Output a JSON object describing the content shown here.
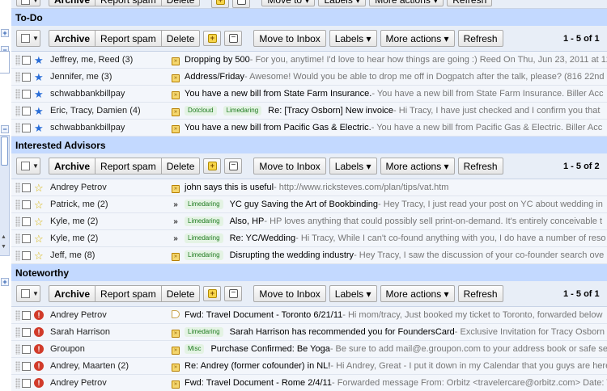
{
  "app": {
    "title": "Gmail - multiple inboxes"
  },
  "colors": {
    "section_bg": "#c3d9ff",
    "toolbar_bg": "#e8eef7",
    "row_bg": "#f3f6fb",
    "label_green_bg": "#e4f3e4",
    "label_green_text": "#1d7a1d",
    "important_red": "#d13b2a",
    "star_blue": "#2a6ed8"
  },
  "top_toolbar": {
    "archive": "Archive",
    "report_spam": "Report spam",
    "delete": "Delete",
    "move_to": "Move to ▾",
    "labels": "Labels ▾",
    "more_actions": "More actions ▾",
    "refresh": "Refresh"
  },
  "gutter_icons": [
    "expand-icon",
    "collapse-icon",
    "collapse-icon",
    "expand-icon"
  ],
  "sections": [
    {
      "title": "To-Do",
      "toolbar": {
        "archive": "Archive",
        "report_spam": "Report spam",
        "delete": "Delete",
        "move_to_inbox": "Move to Inbox",
        "labels": "Labels ▾",
        "more_actions": "More actions ▾",
        "refresh": "Refresh"
      },
      "count": "1 - 5 of 1",
      "rows": [
        {
          "from": "Jeffrey, me, Reed (3)",
          "star": "blue",
          "marker": "box",
          "labels": [],
          "subject": "Dropping by 500",
          "snippet": " - For you, anytime! I'd love to hear how things are going :) Reed On Thu, Jun 23, 2011 at 12"
        },
        {
          "from": "Jennifer, me (3)",
          "star": "blue",
          "marker": "box",
          "labels": [],
          "subject": "Address/Friday",
          "snippet": " - Awesome! Would you be able to drop me off in Dogpatch after the talk, please? (816 22nd"
        },
        {
          "from": "schwabbankbillpay",
          "star": "blue",
          "marker": "box",
          "labels": [],
          "subject": "You have a new bill from State Farm Insurance.",
          "snippet": " - You have a new bill from State Farm Insurance. Biller Acc"
        },
        {
          "from": "Eric, Tracy, Damien (4)",
          "star": "blue",
          "marker": "box",
          "labels": [
            "Dotcloud",
            "Limedaring"
          ],
          "subject": "Re: [Tracy Osborn] New invoice",
          "snippet": " - Hi Tracy, I have just checked and I confirm you that"
        },
        {
          "from": "schwabbankbillpay",
          "star": "blue",
          "marker": "box",
          "labels": [],
          "subject": "You have a new bill from Pacific Gas & Electric.",
          "snippet": " - You have a new bill from Pacific Gas & Electric. Biller Acc"
        }
      ]
    },
    {
      "title": "Interested Advisors",
      "toolbar": {
        "archive": "Archive",
        "report_spam": "Report spam",
        "delete": "Delete",
        "move_to_inbox": "Move to Inbox",
        "labels": "Labels ▾",
        "more_actions": "More actions ▾",
        "refresh": "Refresh"
      },
      "count": "1 - 5 of 2",
      "rows": [
        {
          "from": "Andrey Petrov",
          "star": "empty",
          "marker": "box",
          "labels": [],
          "subject": "john says this is useful",
          "snippet": " - http://www.ricksteves.com/plan/tips/vat.htm"
        },
        {
          "from": "Patrick, me (2)",
          "star": "empty",
          "marker": "double",
          "labels": [
            "Limedaring"
          ],
          "subject": "YC guy Saving the Art of Bookbinding",
          "snippet": " - Hey Tracy, I just read your post on YC about wedding in"
        },
        {
          "from": "Kyle, me (2)",
          "star": "empty",
          "marker": "double",
          "labels": [
            "Limedaring"
          ],
          "subject": "Also, HP",
          "snippet": " - HP loves anything that could possibly sell print-on-demand. It's entirely conceivable t"
        },
        {
          "from": "Kyle, me (2)",
          "star": "empty",
          "marker": "double",
          "labels": [
            "Limedaring"
          ],
          "subject": "Re: YC/Wedding",
          "snippet": " - Hi Tracy, While I can't co-found anything with you, I do have a number of reso"
        },
        {
          "from": "Jeff, me (8)",
          "star": "empty",
          "marker": "box",
          "labels": [
            "Limedaring"
          ],
          "subject": "Disrupting the wedding industry",
          "snippet": " - Hey Tracy, I saw the discussion of your co-founder search ove"
        }
      ]
    },
    {
      "title": "Noteworthy",
      "toolbar": {
        "archive": "Archive",
        "report_spam": "Report spam",
        "delete": "Delete",
        "move_to_inbox": "Move to Inbox",
        "labels": "Labels ▾",
        "more_actions": "More actions ▾",
        "refresh": "Refresh"
      },
      "count": "1 - 5 of 1",
      "rows": [
        {
          "from": "Andrey Petrov",
          "star": "important",
          "marker": "outline",
          "labels": [],
          "subject": "Fwd: Travel Document - Toronto 6/21/11",
          "snippet": " - Hi mom/tracy, Just booked my ticket to Toronto, forwarded below"
        },
        {
          "from": "Sarah Harrison",
          "star": "important",
          "marker": "box",
          "labels": [
            "Limedaring"
          ],
          "subject": "Sarah Harrison has recommended you for FoundersCard",
          "snippet": " - Exclusive Invitation for Tracy Osborn"
        },
        {
          "from": "Groupon",
          "star": "important",
          "marker": "box",
          "labels": [
            "Misc"
          ],
          "subject": "Purchase Confirmed: Be Yoga",
          "snippet": " - Be sure to add mail@e.groupon.com to your address book or safe se"
        },
        {
          "from": "Andrey, Maarten (2)",
          "star": "important",
          "marker": "box",
          "labels": [],
          "subject": "Re: Andrey (former cofounder) in NL!",
          "snippet": " - Hi Andrey, Great - I put it down in my Calendar that you guys are here"
        },
        {
          "from": "Andrey Petrov",
          "star": "important",
          "marker": "box",
          "labels": [],
          "subject": "Fwd: Travel Document - Rome 2/4/11",
          "snippet": " - Forwarded message From: Orbitz <travelercare@orbitz.com> Date: V"
        }
      ]
    }
  ]
}
